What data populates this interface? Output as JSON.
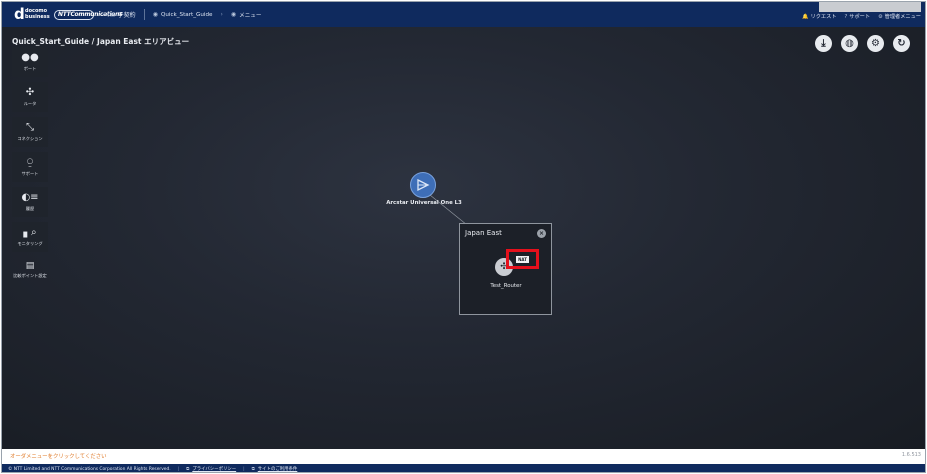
{
  "header": {
    "logo_docomo_mark": "d",
    "logo_docomo_line1": "docomo",
    "logo_docomo_line2": "business",
    "logo_ntt": "NTTCommunications",
    "contract_icon": "contract-icon",
    "contract_label": "子契約",
    "breadcrumb": [
      {
        "label": "Quick_Start_Guide"
      },
      {
        "label": "メニュー"
      }
    ],
    "right_links": [
      {
        "icon": "bell-icon",
        "label": "リクエスト"
      },
      {
        "icon": "help-icon",
        "label": "サポート"
      },
      {
        "icon": "gear-icon",
        "label": "管理者メニュー"
      }
    ]
  },
  "page": {
    "title": "Quick_Start_Guide / Japan East エリアビュー"
  },
  "left_menu": [
    {
      "icon": "port-icon",
      "label": "ポート"
    },
    {
      "icon": "router-icon",
      "label": "ルータ"
    },
    {
      "icon": "connection-icon",
      "label": "コネクション"
    },
    {
      "icon": "support-icon",
      "label": "サポート"
    },
    {
      "icon": "history-icon",
      "label": "履歴"
    },
    {
      "icon": "monitoring-icon",
      "label": "モニタリング"
    },
    {
      "icon": "contact-icon",
      "label": "比較ポイント設定"
    }
  ],
  "top_actions": [
    {
      "icon": "download-icon"
    },
    {
      "icon": "globe-icon"
    },
    {
      "icon": "settings-icon"
    },
    {
      "icon": "refresh-icon"
    }
  ],
  "topology": {
    "au_label": "Arcstar Universal One L3",
    "area_title": "Japan East",
    "router_label": "Test_Router",
    "nat_badge": "NAT",
    "highlight_color": "#e5101c"
  },
  "bottom": {
    "message": "オーダメニューをクリックしてください",
    "version": "1.6.513"
  },
  "footer": {
    "copyright": "© NTT Limited and NTT Communications Corporation All Rights Reserved.",
    "privacy": "プライバシーポリシー",
    "site_terms": "サイトのご利用条件"
  },
  "colors": {
    "header_bg": "#0f2a5e",
    "canvas_bg": "#1f242c",
    "accent_orange": "#e07b2a",
    "node_blue": "#3e6eb7"
  }
}
